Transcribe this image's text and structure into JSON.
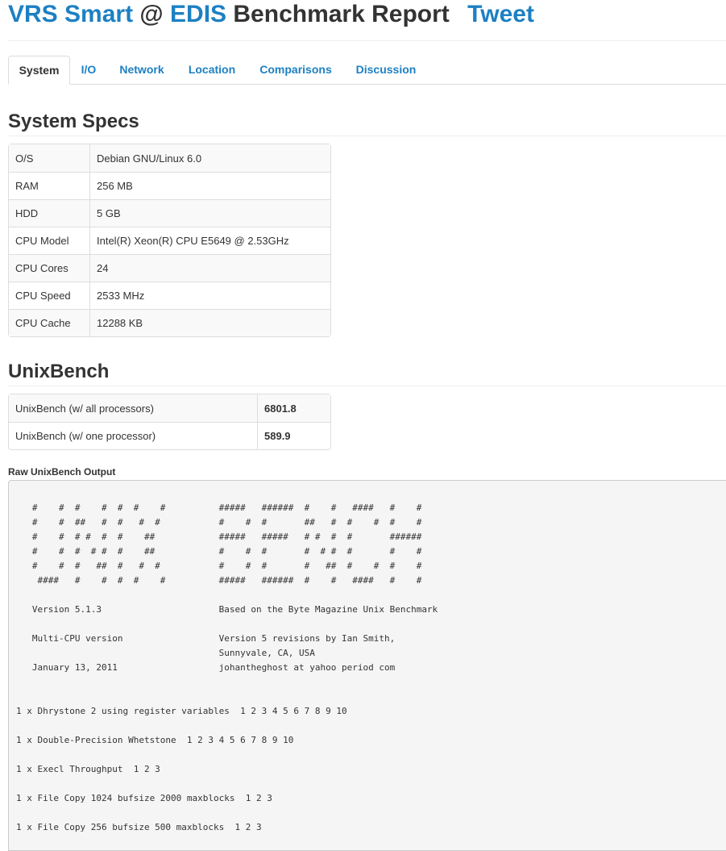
{
  "header": {
    "host": "VRS Smart",
    "at": "@",
    "provider": "EDIS",
    "suffix": "Benchmark Report",
    "tweet": "Tweet"
  },
  "tabs": [
    "System",
    "I/O",
    "Network",
    "Location",
    "Comparisons",
    "Discussion"
  ],
  "system_specs": {
    "heading": "System Specs",
    "rows": [
      {
        "key": "O/S",
        "value": "Debian GNU/Linux 6.0"
      },
      {
        "key": "RAM",
        "value": "256 MB"
      },
      {
        "key": "HDD",
        "value": "5 GB"
      },
      {
        "key": "CPU Model",
        "value": "Intel(R) Xeon(R) CPU E5649 @ 2.53GHz"
      },
      {
        "key": "CPU Cores",
        "value": "24"
      },
      {
        "key": "CPU Speed",
        "value": "2533 MHz"
      },
      {
        "key": "CPU Cache",
        "value": "12288 KB"
      }
    ]
  },
  "unixbench": {
    "heading": "UnixBench",
    "rows": [
      {
        "key": "UnixBench (w/ all processors)",
        "value": "6801.8"
      },
      {
        "key": "UnixBench (w/ one processor)",
        "value": "589.9"
      }
    ],
    "raw_label": "Raw UnixBench Output",
    "raw_output": "   #    #  #    #  #  #    #          #####   ######  #    #   ####   #    #\n   #    #  ##   #  #   #  #           #    #  #       ##   #  #    #  #    #\n   #    #  # #  #  #    ##            #####   #####   # #  #  #       ######\n   #    #  #  # #  #    ##            #    #  #       #  # #  #       #    #\n   #    #  #   ##  #   #  #           #    #  #       #   ##  #    #  #    #\n    ####   #    #  #  #    #          #####   ######  #    #   ####   #    #\n\n   Version 5.1.3                      Based on the Byte Magazine Unix Benchmark\n\n   Multi-CPU version                  Version 5 revisions by Ian Smith,\n                                      Sunnyvale, CA, USA\n   January 13, 2011                   johantheghost at yahoo period com\n\n\n1 x Dhrystone 2 using register variables  1 2 3 4 5 6 7 8 9 10\n\n1 x Double-Precision Whetstone  1 2 3 4 5 6 7 8 9 10\n\n1 x Execl Throughput  1 2 3\n\n1 x File Copy 1024 bufsize 2000 maxblocks  1 2 3\n\n1 x File Copy 256 bufsize 500 maxblocks  1 2 3"
  }
}
